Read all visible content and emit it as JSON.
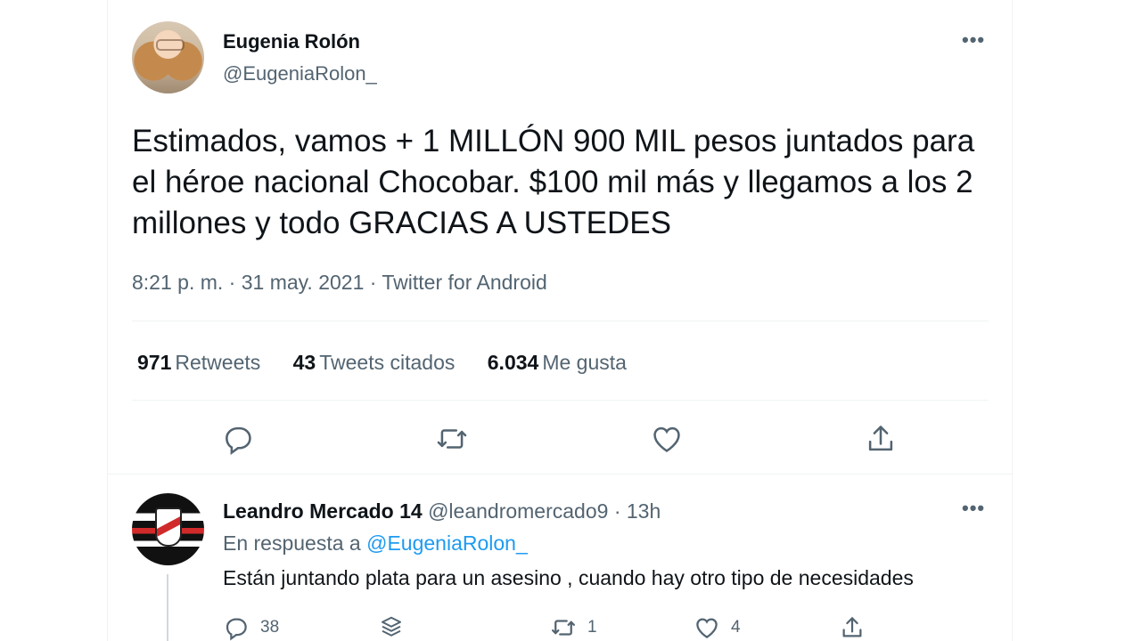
{
  "tweet": {
    "author_name": "Eugenia Rolón",
    "author_handle": "@EugeniaRolon_",
    "more_icon": "more-icon",
    "text": "Estimados, vamos + 1 MILLÓN 900 MIL pesos juntados para el héroe nacional Chocobar. $100 mil más y llegamos a los 2 millones y todo GRACIAS A USTEDES",
    "meta": "8:21 p. m. · 31 may. 2021 · Twitter for Android",
    "stats": [
      {
        "count": "971",
        "label": "Retweets"
      },
      {
        "count": "43",
        "label": "Tweets citados"
      },
      {
        "count": "6.034",
        "label": "Me gusta"
      }
    ],
    "actions": [
      "reply-icon",
      "retweet-icon",
      "like-icon",
      "share-icon"
    ]
  },
  "reply": {
    "author_name": "Leandro Mercado 14",
    "author_handle": "@leandromercado9",
    "time": "· 13h",
    "reply_to_prefix": "En respuesta a",
    "reply_to_handle": "@EugeniaRolon_",
    "text": "Están juntando plata para un asesino , cuando hay otro tipo de necesidades",
    "actions": [
      {
        "icon": "reply-icon",
        "count": "38"
      },
      {
        "icon": "stack-icon",
        "count": ""
      },
      {
        "icon": "retweet-icon",
        "count": "1"
      },
      {
        "icon": "like-icon",
        "count": "4"
      },
      {
        "icon": "share-icon",
        "count": ""
      }
    ]
  },
  "colors": {
    "text": "#0f1419",
    "secondary": "#536471",
    "link": "#1d9bf0",
    "divider": "#eff3f4"
  }
}
